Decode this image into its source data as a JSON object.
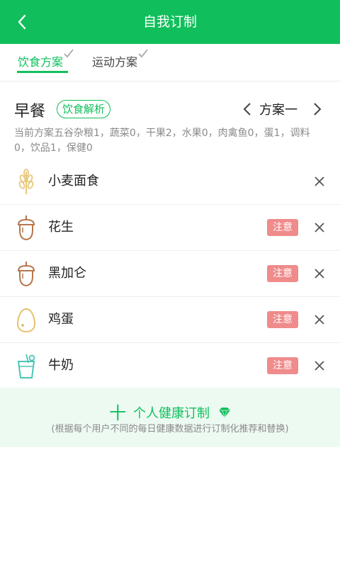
{
  "header": {
    "title": "自我订制"
  },
  "tabs": [
    {
      "label": "饮食方案",
      "active": true
    },
    {
      "label": "运动方案",
      "active": false
    }
  ],
  "meal": {
    "title": "早餐",
    "analysis_label": "饮食解析",
    "plan_name": "方案一",
    "summary": "当前方案五谷杂粮1，蔬菜0，干果2，水果0，肉禽鱼0，蛋1，调料0，饮品1，保健0"
  },
  "foods": [
    {
      "name": "小麦面食",
      "icon": "wheat-icon",
      "warning": null
    },
    {
      "name": "花生",
      "icon": "acorn-icon",
      "warning": "注意"
    },
    {
      "name": "黑加仑",
      "icon": "acorn-icon",
      "warning": "注意"
    },
    {
      "name": "鸡蛋",
      "icon": "egg-icon",
      "warning": "注意"
    },
    {
      "name": "牛奶",
      "icon": "drink-icon",
      "warning": "注意"
    }
  ],
  "custom": {
    "plus": "十",
    "title": "个人健康订制",
    "subtitle": "(根据每个用户不同的每日健康数据进行订制化推荐和替换)"
  },
  "colors": {
    "accent": "#10bf5c",
    "warning": "#ef8b8b",
    "panel_bg": "#edfaf2"
  }
}
